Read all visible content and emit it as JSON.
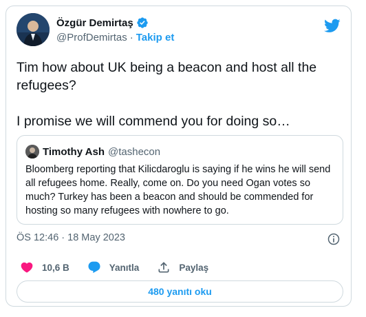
{
  "author": {
    "display_name": "Özgür Demirtaş",
    "handle": "@ProfDemirtas",
    "separator": "·",
    "follow_label": "Takip et"
  },
  "tweet": {
    "paragraphs": [
      "Tim how about UK being a beacon and host all the refugees?",
      "I promise we will commend you for doing so…"
    ]
  },
  "quote": {
    "display_name": "Timothy Ash",
    "handle": "@tashecon",
    "text": "Bloomberg reporting that Kilicdaroglu is saying if he wins he will send all refugees home. Really, come on. Do you need Ogan votes so much? Turkey has been a beacon and should be commended for hosting so many refugees with nowhere to go."
  },
  "meta": {
    "timestamp": "ÖS 12:46 · 18 May 2023"
  },
  "actions": {
    "like_count": "10,6 B",
    "reply_label": "Yanıtla",
    "share_label": "Paylaş"
  },
  "footer": {
    "read_replies_label": "480 yanıtı oku"
  },
  "colors": {
    "accent": "#1d9bf0",
    "like": "#f91880",
    "muted": "#536471",
    "border": "#cfd9de"
  }
}
